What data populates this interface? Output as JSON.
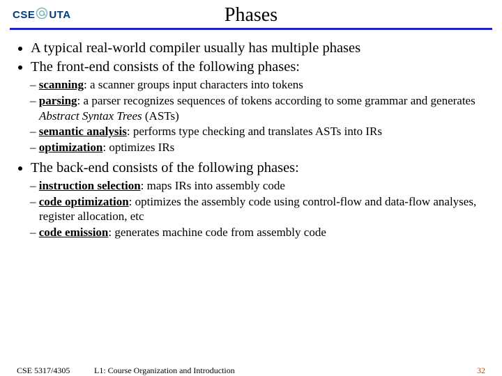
{
  "logo": {
    "left": "CSE",
    "right": "UTA",
    "iconColor": "#7eb7b7"
  },
  "title": "Phases",
  "bullets": {
    "b1": "A typical real-world compiler usually has multiple phases",
    "b2": "The front-end consists of the following phases:",
    "b3": "The back-end consists of the following phases:"
  },
  "front": {
    "s1": {
      "term": "scanning",
      "rest": ": a scanner groups input characters into tokens"
    },
    "s2": {
      "term": "parsing",
      "rest1": ": a parser recognizes sequences of tokens according to some grammar and generates ",
      "ital": "Abstract Syntax Trees",
      "rest2": " (ASTs)"
    },
    "s3": {
      "term": "semantic analysis",
      "rest": ": performs type checking and translates ASTs into IRs"
    },
    "s4": {
      "term": "optimization",
      "rest": ": optimizes IRs"
    }
  },
  "back": {
    "s1": {
      "term": "instruction selection",
      "rest": ": maps IRs into assembly code"
    },
    "s2": {
      "term": "code optimization",
      "rest": ": optimizes the assembly code using control-flow and data-flow analyses, register allocation, etc"
    },
    "s3": {
      "term": "code emission",
      "rest": ": generates machine code from assembly code"
    }
  },
  "footer": {
    "course": "CSE 5317/4305",
    "lecture": "L1: Course Organization and Introduction",
    "page": "32"
  }
}
